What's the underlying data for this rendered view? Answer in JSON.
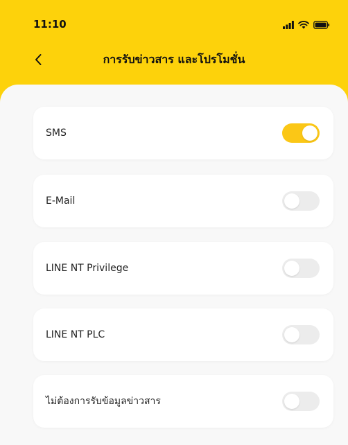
{
  "status_bar": {
    "time": "11:10",
    "icons": [
      "signal-icon",
      "wifi-icon",
      "battery-icon"
    ]
  },
  "header": {
    "title": "การรับข่าวสาร และโปรโมชั่น",
    "back_icon": "chevron-left-icon"
  },
  "colors": {
    "accent": "#FDD20B",
    "toggle_on": "#FBC716",
    "toggle_off": "#ECECEC",
    "sheet_bg": "#F8F8F8"
  },
  "settings": {
    "items": [
      {
        "label": "SMS",
        "enabled": true
      },
      {
        "label": "E-Mail",
        "enabled": false
      },
      {
        "label": "LINE NT Privilege",
        "enabled": false
      },
      {
        "label": "LINE NT PLC",
        "enabled": false
      },
      {
        "label": "ไม่ต้องการรับข้อมูลข่าวสาร",
        "enabled": false
      }
    ]
  }
}
